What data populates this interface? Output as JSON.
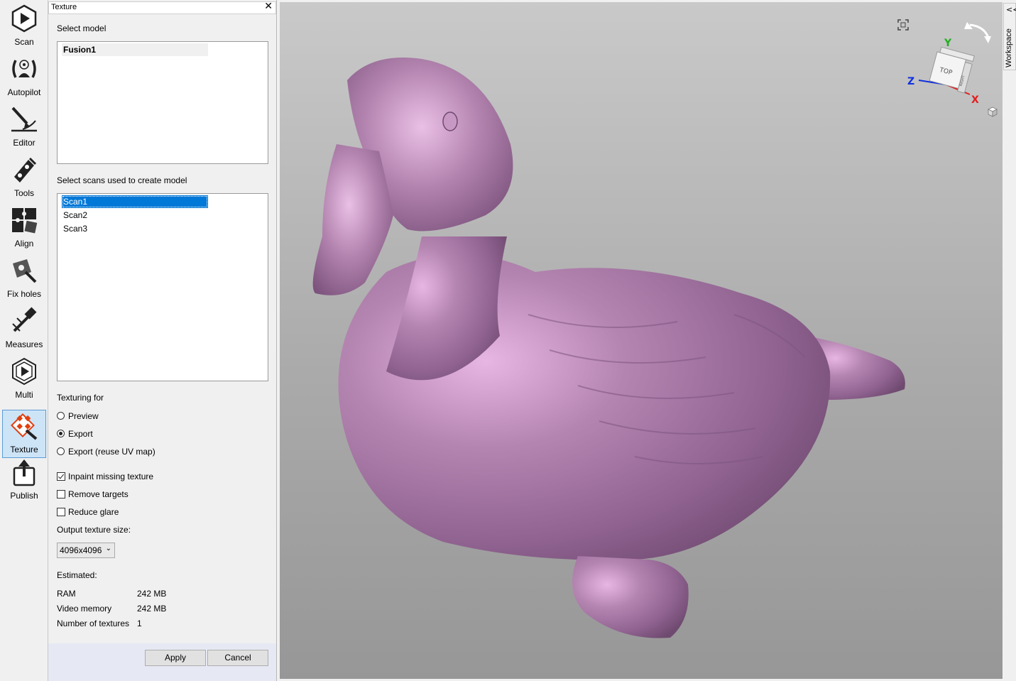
{
  "toolbar": {
    "items": [
      {
        "label": "Scan",
        "icon": "scan-icon"
      },
      {
        "label": "Autopilot",
        "icon": "autopilot-icon"
      },
      {
        "label": "Editor",
        "icon": "editor-icon"
      },
      {
        "label": "Tools",
        "icon": "tools-icon"
      },
      {
        "label": "Align",
        "icon": "align-icon"
      },
      {
        "label": "Fix holes",
        "icon": "fix-holes-icon"
      },
      {
        "label": "Measures",
        "icon": "measures-icon"
      },
      {
        "label": "Multi",
        "icon": "multi-icon"
      },
      {
        "label": "Texture",
        "icon": "texture-icon",
        "active": true
      },
      {
        "label": "Publish",
        "icon": "publish-icon"
      }
    ]
  },
  "panel": {
    "title": "Texture",
    "close_glyph": "✕",
    "select_model_label": "Select model",
    "models": [
      "Fusion1"
    ],
    "select_scans_label": "Select scans used to create model",
    "scans": [
      "Scan1",
      "Scan2",
      "Scan3"
    ],
    "selected_scan": "Scan1",
    "texturing_for_label": "Texturing for",
    "texturing_options": [
      {
        "label": "Preview",
        "checked": false
      },
      {
        "label": "Export",
        "checked": true
      },
      {
        "label": "Export (reuse UV map)",
        "checked": false
      }
    ],
    "checkboxes": [
      {
        "label": "Inpaint missing texture",
        "checked": true
      },
      {
        "label": "Remove targets",
        "checked": false
      },
      {
        "label": "Reduce glare",
        "checked": false
      }
    ],
    "output_size_label": "Output texture size:",
    "output_size_value": "4096x4096",
    "estimated_label": "Estimated:",
    "estimates": [
      {
        "key": "RAM",
        "value": "242 MB"
      },
      {
        "key": "Video memory",
        "value": "242 MB"
      },
      {
        "key": "Number of textures",
        "value": "1"
      }
    ],
    "apply_label": "Apply",
    "cancel_label": "Cancel"
  },
  "viewport": {
    "gizmo": {
      "axis_x": "X",
      "axis_y": "Y",
      "axis_z": "Z",
      "face_top": "TOP",
      "face_right": "RIGHT"
    },
    "model_color": "#b07fab",
    "workspace_label": "Workspace",
    "workspace_chevron": "<<"
  },
  "colors": {
    "selection": "#0078d7",
    "axis_x": "#e02020",
    "axis_y": "#20b020",
    "axis_z": "#1030e0"
  }
}
